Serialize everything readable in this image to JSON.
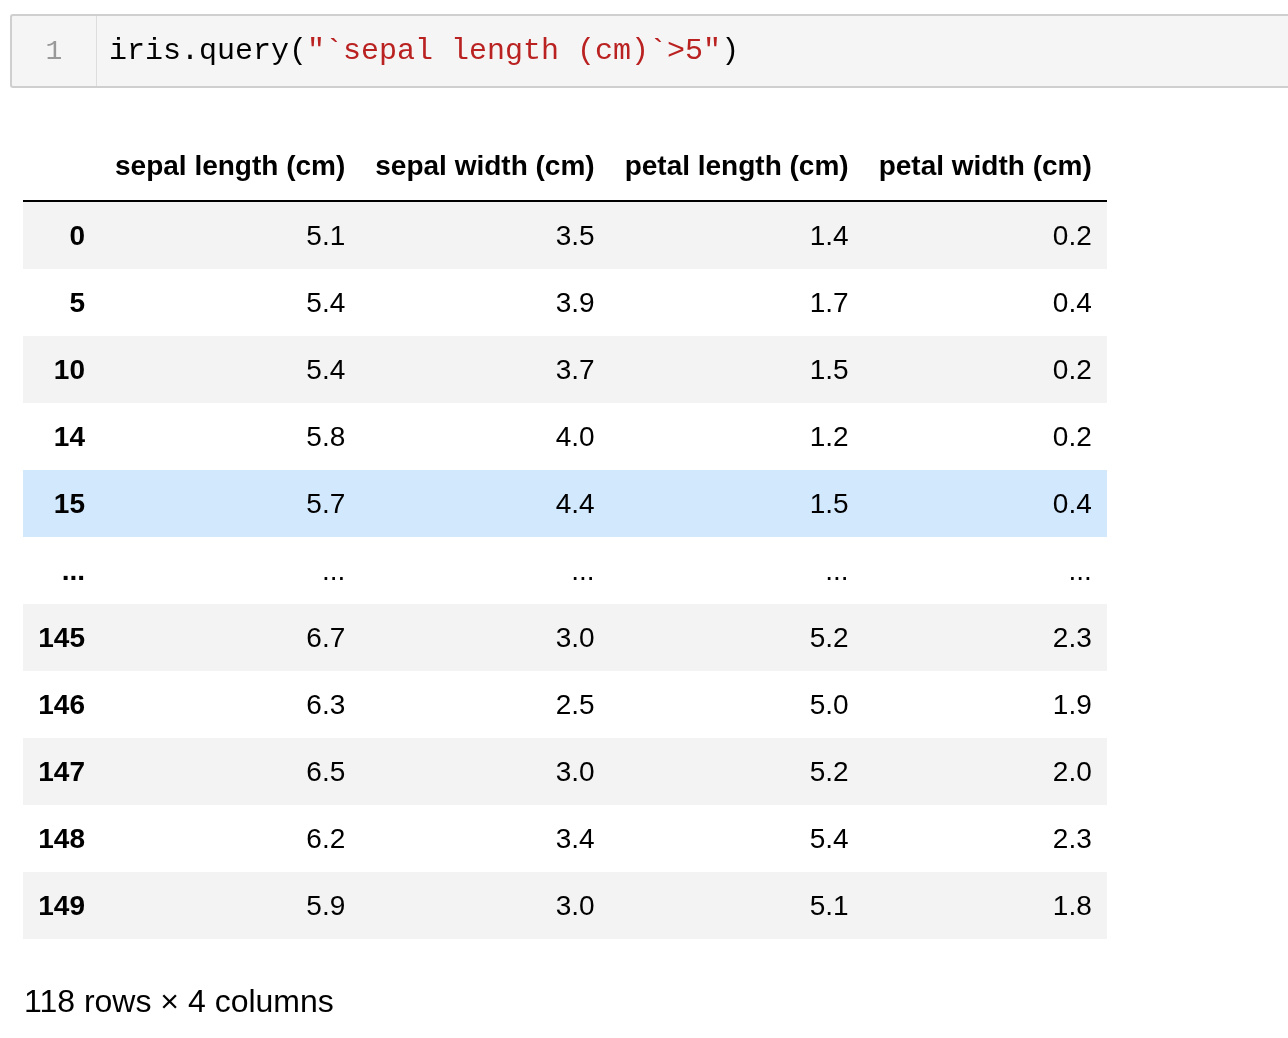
{
  "code_cell": {
    "line_number": "1",
    "tokens": [
      {
        "kind": "plain",
        "text": "iris.query("
      },
      {
        "kind": "string",
        "text": "\"`sepal length (cm)`>5\""
      },
      {
        "kind": "plain",
        "text": ")"
      }
    ]
  },
  "table": {
    "columns": [
      "sepal length (cm)",
      "sepal width (cm)",
      "petal length (cm)",
      "petal width (cm)"
    ],
    "rows": [
      {
        "index": "0",
        "cells": [
          "5.1",
          "3.5",
          "1.4",
          "0.2"
        ],
        "selected": false
      },
      {
        "index": "5",
        "cells": [
          "5.4",
          "3.9",
          "1.7",
          "0.4"
        ],
        "selected": false
      },
      {
        "index": "10",
        "cells": [
          "5.4",
          "3.7",
          "1.5",
          "0.2"
        ],
        "selected": false
      },
      {
        "index": "14",
        "cells": [
          "5.8",
          "4.0",
          "1.2",
          "0.2"
        ],
        "selected": false
      },
      {
        "index": "15",
        "cells": [
          "5.7",
          "4.4",
          "1.5",
          "0.4"
        ],
        "selected": true
      },
      {
        "index": "...",
        "cells": [
          "...",
          "...",
          "...",
          "..."
        ],
        "selected": false
      },
      {
        "index": "145",
        "cells": [
          "6.7",
          "3.0",
          "5.2",
          "2.3"
        ],
        "selected": false
      },
      {
        "index": "146",
        "cells": [
          "6.3",
          "2.5",
          "5.0",
          "1.9"
        ],
        "selected": false
      },
      {
        "index": "147",
        "cells": [
          "6.5",
          "3.0",
          "5.2",
          "2.0"
        ],
        "selected": false
      },
      {
        "index": "148",
        "cells": [
          "6.2",
          "3.4",
          "5.4",
          "2.3"
        ],
        "selected": false
      },
      {
        "index": "149",
        "cells": [
          "5.9",
          "3.0",
          "5.1",
          "1.8"
        ],
        "selected": false
      }
    ]
  },
  "footer": "118 rows × 4 columns"
}
